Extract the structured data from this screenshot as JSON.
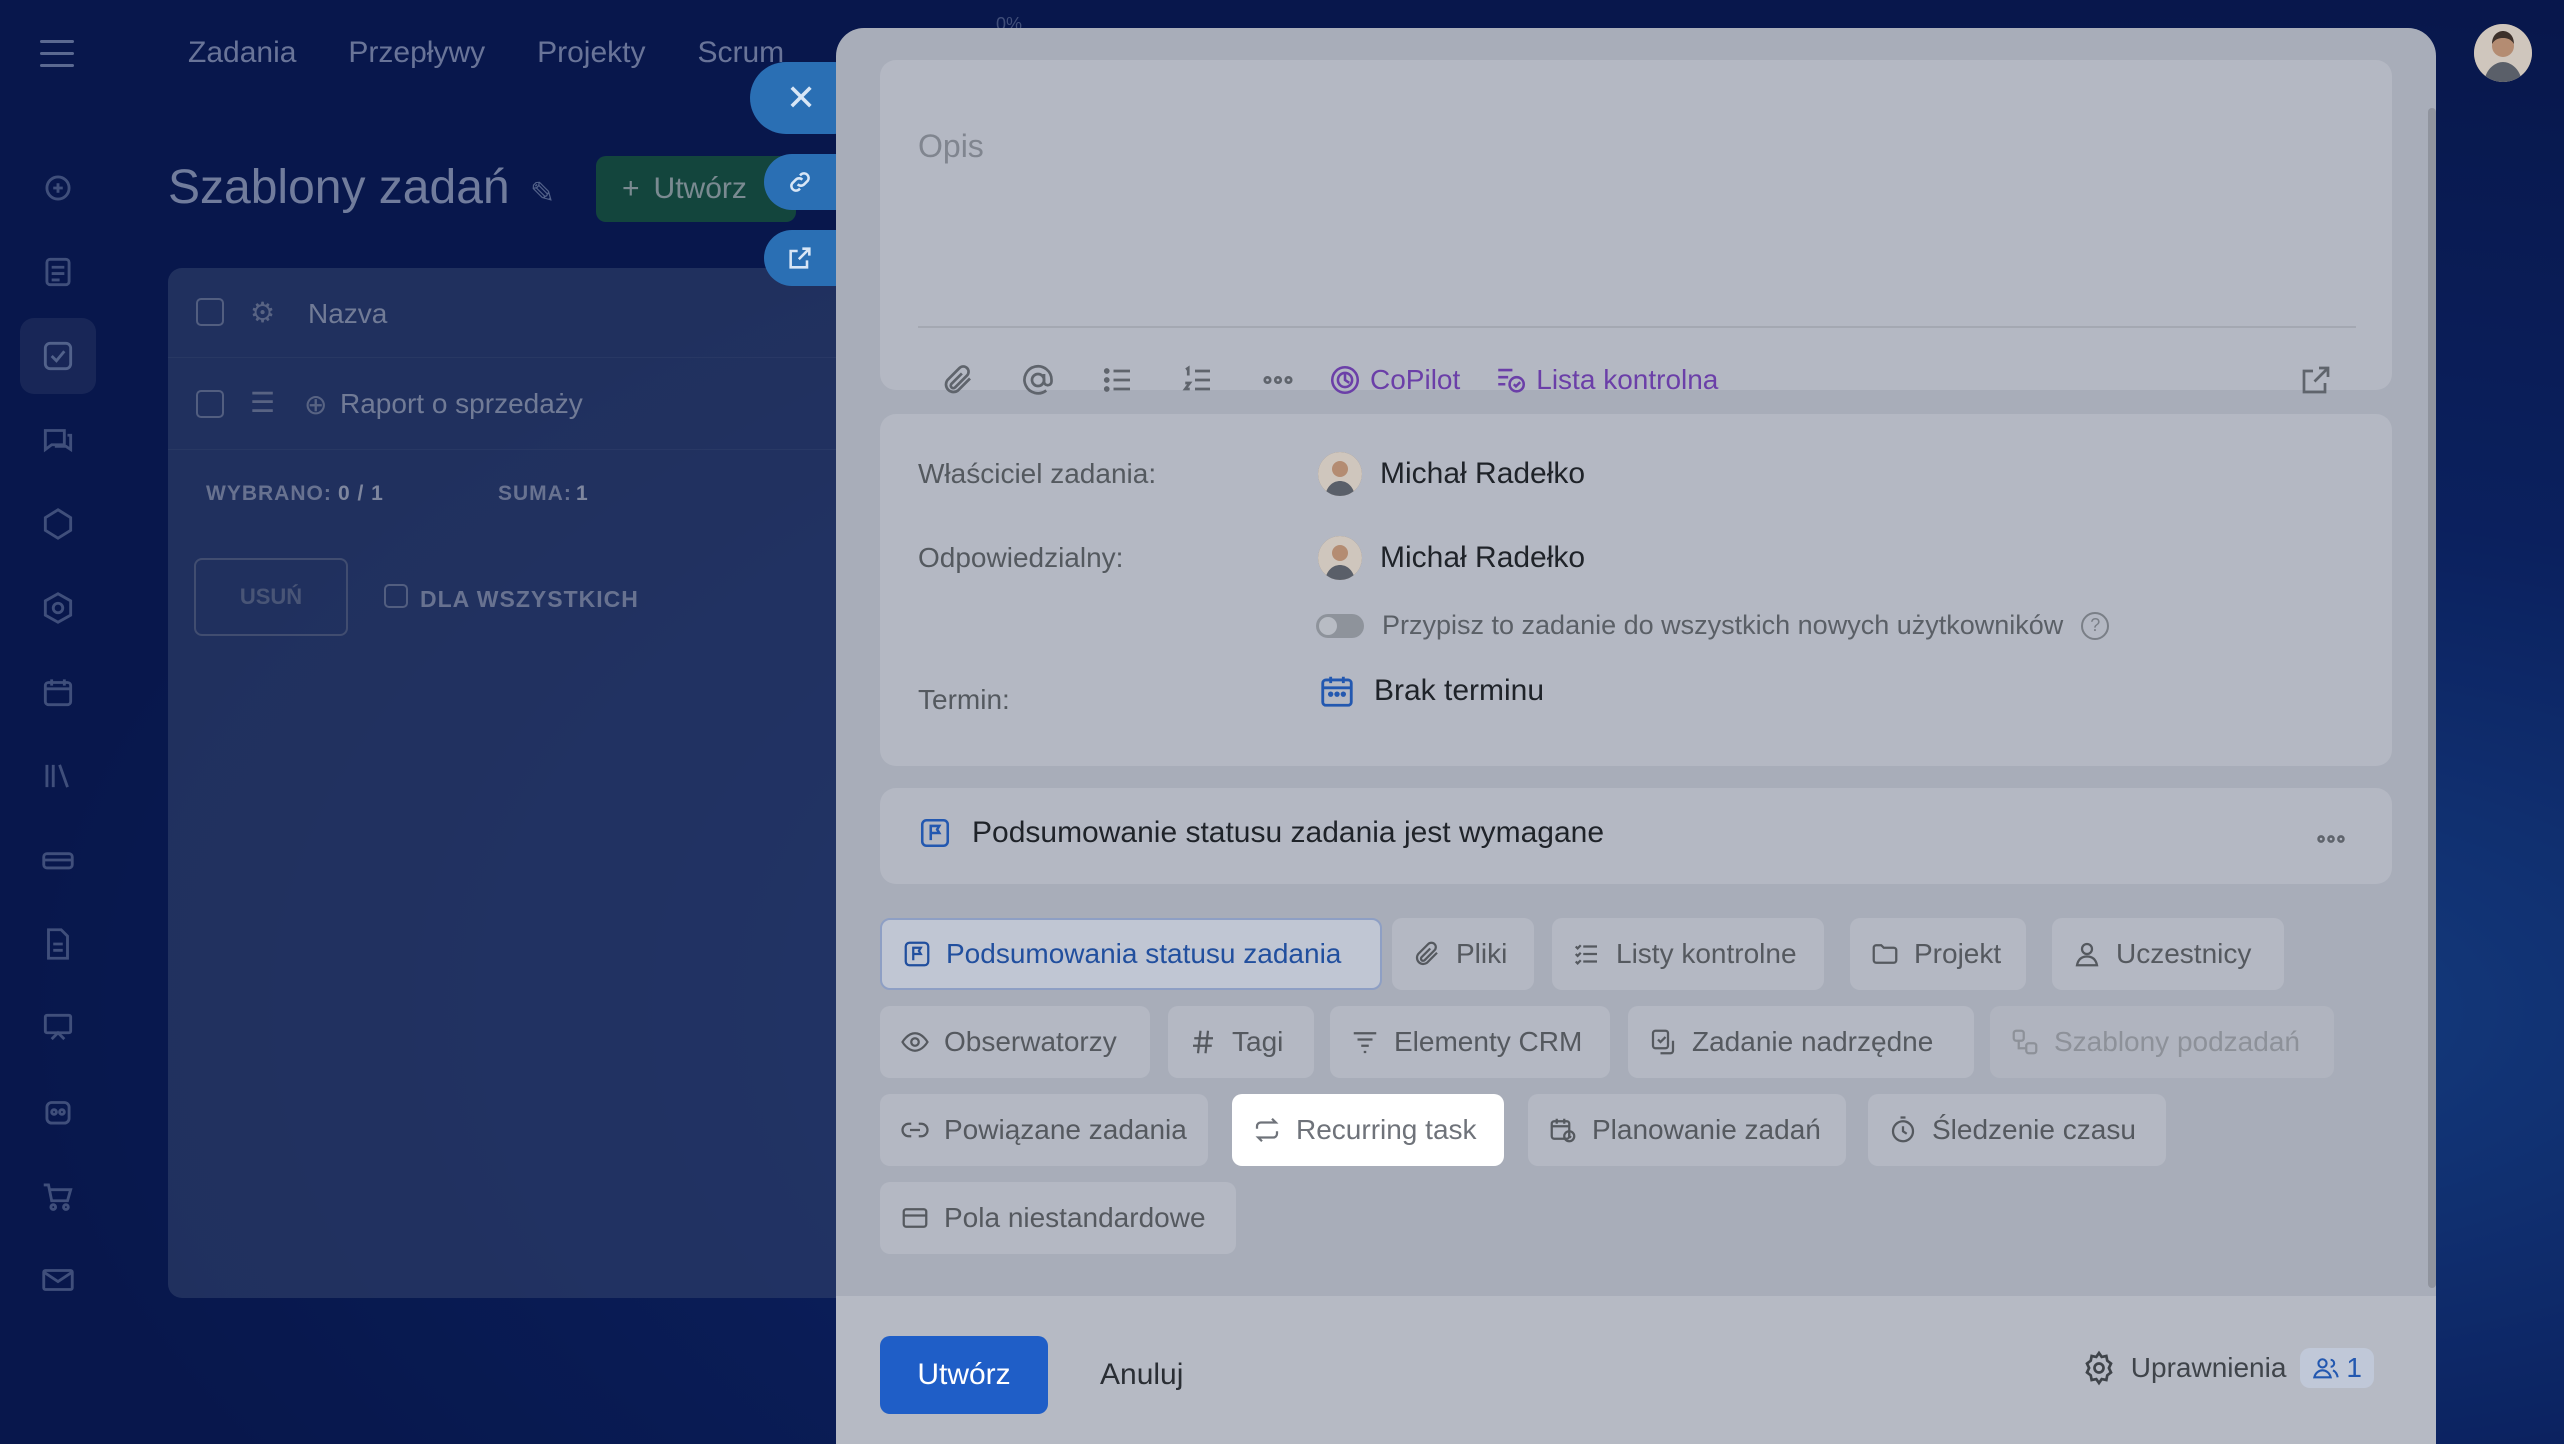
{
  "background": {
    "nav": [
      "Zadania",
      "Przepływy",
      "Projekty",
      "Scrum"
    ],
    "progress_label": "0%",
    "page_title": "Szablony zadań",
    "create_button": "Utwórz",
    "grid": {
      "header_name": "Nazva",
      "rows": [
        "Raport o sprzedaży"
      ],
      "selected_label": "WYBRANO:",
      "selected_value": "0 / 1",
      "sum_label": "SUMA:",
      "sum_value": "1",
      "delete_button": "USUŃ",
      "for_all_label": "DLA WSZYSTKICH"
    }
  },
  "slider": {
    "description_placeholder": "Opis",
    "toolbar": {
      "copilot_label": "CoPilot",
      "checklist_label": "Lista kontrolna"
    },
    "fields": {
      "owner_label": "Właściciel zadania:",
      "owner_name": "Michał Radełko",
      "responsible_label": "Odpowiedzialny:",
      "responsible_name": "Michał Radełko",
      "assign_all_label": "Przypisz to zadanie do wszystkich nowych użytkowników",
      "deadline_label": "Termin:",
      "deadline_value": "Brak terminu"
    },
    "status_summary": "Podsumowanie statusu zadania jest wymagane",
    "chips": [
      "Podsumowania statusu zadania",
      "Pliki",
      "Listy kontrolne",
      "Projekt",
      "Uczestnicy",
      "Obserwatorzy",
      "Tagi",
      "Elementy CRM",
      "Zadanie nadrzędne",
      "Szablony podzadań",
      "Powiązane zadania",
      "Recurring task",
      "Planowanie zadań",
      "Śledzenie czasu",
      "Pola niestandardowe"
    ],
    "footer": {
      "create_button": "Utwórz",
      "cancel_button": "Anuluj",
      "permissions_label": "Uprawnienia",
      "permissions_count": "1"
    }
  },
  "colors": {
    "primary": "#1f5ec7",
    "copilot": "#6b3fa8",
    "highlight_chip": "#ffffff"
  }
}
